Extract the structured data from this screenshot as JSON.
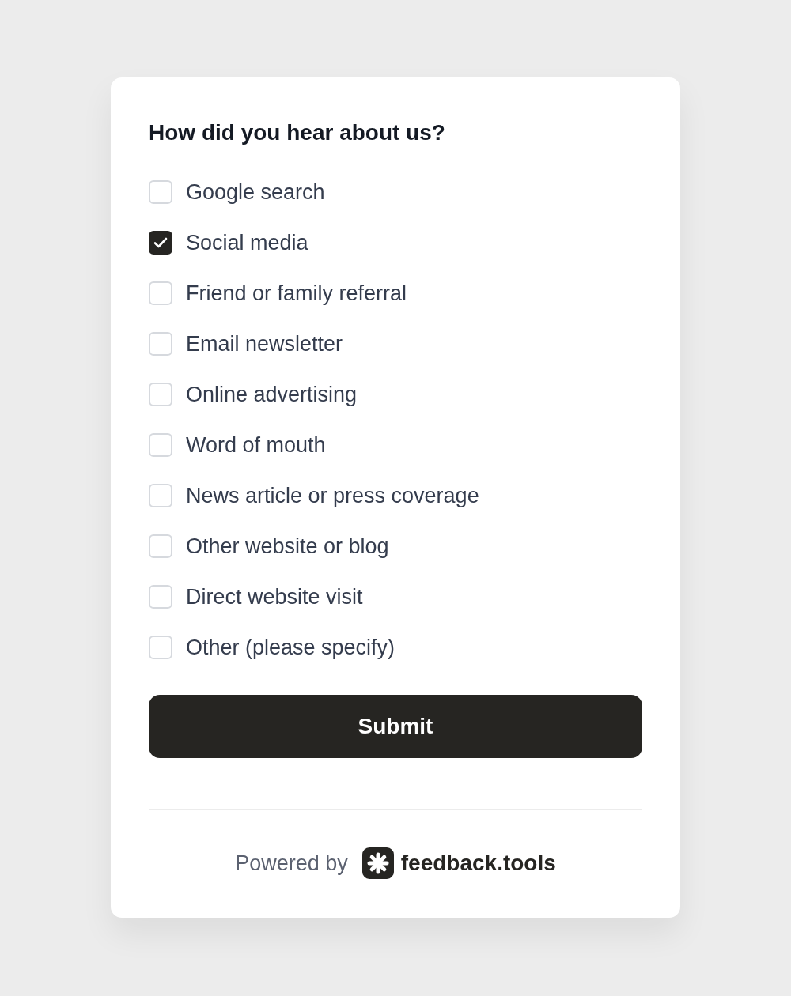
{
  "form": {
    "title": "How did you hear about us?",
    "options": [
      {
        "label": "Google search",
        "checked": false
      },
      {
        "label": "Social media",
        "checked": true
      },
      {
        "label": "Friend or family referral",
        "checked": false
      },
      {
        "label": "Email newsletter",
        "checked": false
      },
      {
        "label": "Online advertising",
        "checked": false
      },
      {
        "label": "Word of mouth",
        "checked": false
      },
      {
        "label": "News article or press coverage",
        "checked": false
      },
      {
        "label": "Other website or blog",
        "checked": false
      },
      {
        "label": "Direct website visit",
        "checked": false
      },
      {
        "label": "Other (please specify)",
        "checked": false
      }
    ],
    "submit": "Submit"
  },
  "footer": {
    "powered_by": "Powered by",
    "brand": "feedback.tools"
  }
}
